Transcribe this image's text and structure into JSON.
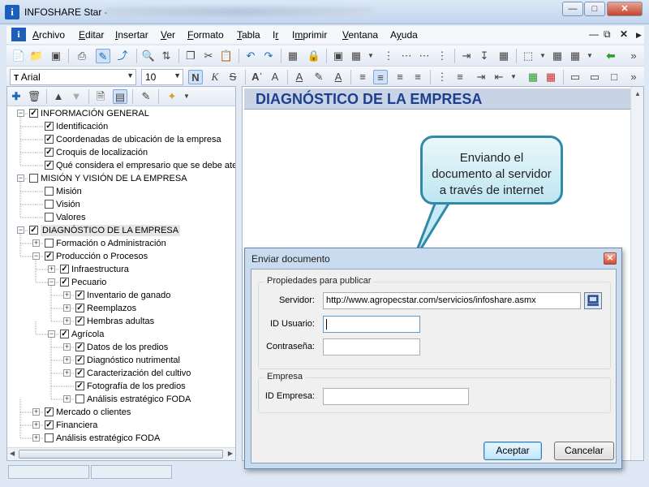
{
  "window": {
    "title": "INFOSHARE Star -",
    "app_icon": "info-icon",
    "buttons": [
      "minimize",
      "maximize",
      "close"
    ]
  },
  "menubar": {
    "items": [
      {
        "label": "Archivo",
        "accel": "A"
      },
      {
        "label": "Editar",
        "accel": "E"
      },
      {
        "label": "Insertar",
        "accel": "I"
      },
      {
        "label": "Ver",
        "accel": "V"
      },
      {
        "label": "Formato",
        "accel": "F"
      },
      {
        "label": "Tabla",
        "accel": "T"
      },
      {
        "label": "Ir",
        "accel": "r"
      },
      {
        "label": "Imprimir",
        "accel": "m"
      },
      {
        "label": "Ventana",
        "accel": "V"
      },
      {
        "label": "Ayuda",
        "accel": "y"
      }
    ]
  },
  "format_toolbar": {
    "font": "Arial",
    "size": "10"
  },
  "tree": {
    "nodes": [
      {
        "label": "INFORMACIÓN GENERAL",
        "checked": true,
        "level": 0,
        "expander": "minus"
      },
      {
        "label": "Identificación",
        "checked": true,
        "level": 1
      },
      {
        "label": "Coordenadas de ubicación de la empresa",
        "checked": true,
        "level": 1
      },
      {
        "label": "Croquis de localización",
        "checked": true,
        "level": 1
      },
      {
        "label": "Qué considera el empresario que se debe aten",
        "checked": true,
        "level": 1
      },
      {
        "label": "MISIÓN Y VISIÓN DE LA EMPRESA",
        "checked": false,
        "level": 0,
        "expander": "minus"
      },
      {
        "label": "Misión",
        "checked": false,
        "level": 1
      },
      {
        "label": "Visión",
        "checked": false,
        "level": 1
      },
      {
        "label": "Valores",
        "checked": false,
        "level": 1
      },
      {
        "label": "DIAGNÓSTICO DE LA EMPRESA",
        "checked": true,
        "level": 0,
        "expander": "minus",
        "highlight": true
      },
      {
        "label": "Formación o Administración",
        "checked": false,
        "level": 1,
        "expander": "plus"
      },
      {
        "label": "Producción o Procesos",
        "checked": true,
        "level": 1,
        "expander": "minus"
      },
      {
        "label": "Infraestructura",
        "checked": true,
        "level": 2,
        "expander": "plus"
      },
      {
        "label": "Pecuario",
        "checked": true,
        "level": 2,
        "expander": "minus"
      },
      {
        "label": "Inventario de ganado",
        "checked": true,
        "level": 3,
        "expander": "plus"
      },
      {
        "label": "Reemplazos",
        "checked": true,
        "level": 3,
        "expander": "plus"
      },
      {
        "label": "Hembras adultas",
        "checked": true,
        "level": 3,
        "expander": "plus"
      },
      {
        "label": "Agrícola",
        "checked": true,
        "level": 2,
        "expander": "minus"
      },
      {
        "label": "Datos de los predios",
        "checked": true,
        "level": 3,
        "expander": "plus"
      },
      {
        "label": "Diagnóstico nutrimental",
        "checked": true,
        "level": 3,
        "expander": "plus"
      },
      {
        "label": "Caracterización del cultivo",
        "checked": true,
        "level": 3,
        "expander": "plus"
      },
      {
        "label": "Fotografía de los predios",
        "checked": true,
        "level": 3
      },
      {
        "label": "Análisis estratégico FODA",
        "checked": false,
        "level": 3,
        "expander": "plus"
      },
      {
        "label": "Mercado o clientes",
        "checked": true,
        "level": 1,
        "expander": "plus"
      },
      {
        "label": "Financiera",
        "checked": true,
        "level": 1,
        "expander": "plus"
      },
      {
        "label": "Análisis estratégico FODA",
        "checked": false,
        "level": 1,
        "expander": "plus"
      }
    ]
  },
  "document": {
    "heading": "DIAGNÓSTICO DE LA EMPRESA"
  },
  "callout": {
    "line1": "Enviando el",
    "line2": "documento al servidor",
    "line3": "a través de internet"
  },
  "dialog": {
    "title": "Enviar documento",
    "group_publish": "Propiedades para publicar",
    "server_label": "Servidor:",
    "server_value": "http://www.agropecstar.com/servicios/infoshare.asmx",
    "user_label": "ID Usuario:",
    "user_value": "",
    "password_label": "Contraseña:",
    "password_value": "",
    "group_company": "Empresa",
    "company_label": "ID Empresa:",
    "company_value": "",
    "accept": "Aceptar",
    "cancel": "Cancelar"
  },
  "colors": {
    "heading_text": "#1e3f8e",
    "callout_border": "#2f8aa8",
    "dialog_frame": "#c9dbee"
  }
}
